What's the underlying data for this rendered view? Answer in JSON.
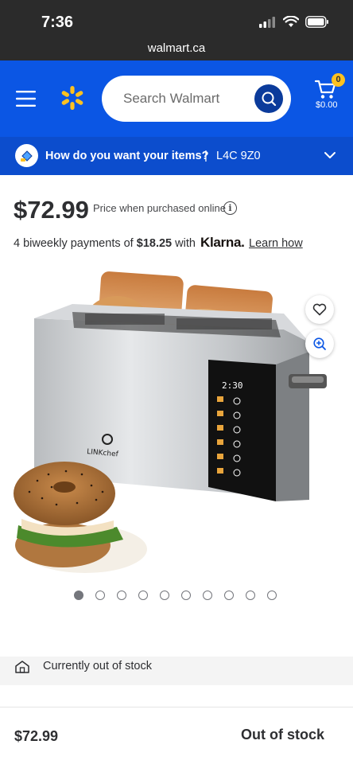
{
  "status_bar": {
    "time": "7:36"
  },
  "browser": {
    "url": "walmart.ca"
  },
  "header": {
    "search_placeholder": "Search Walmart",
    "cart_count": "0",
    "cart_total": "$0.00"
  },
  "fulfilment": {
    "question": "How do you want your items?",
    "separator": "|",
    "postal_code": "L4C 9Z0"
  },
  "product": {
    "price": "$72.99",
    "price_note": "Price when purchased online",
    "info_glyph": "i",
    "payments_prefix": "4 biweekly payments of ",
    "payments_amount": "$18.25",
    "payments_suffix": " with",
    "klarna_brand": "Klarna.",
    "learn_how": "Learn how",
    "image_count": 10,
    "active_image": 1,
    "brand_on_product": "LINKchef",
    "toaster_display": "2:30"
  },
  "availability": {
    "stock_text": "Currently out of stock"
  },
  "bottom_bar": {
    "price": "$72.99",
    "status": "Out of stock"
  },
  "colors": {
    "brand_blue": "#0b56e4",
    "fulfilment_blue": "#0c4dcd",
    "spark_yellow": "#ffc220",
    "search_button": "#0b3b9b"
  }
}
